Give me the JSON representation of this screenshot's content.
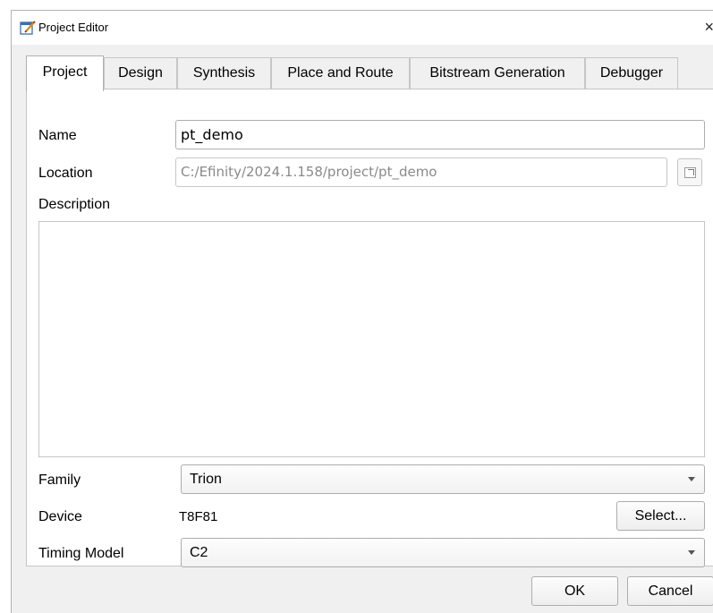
{
  "window": {
    "title": "Project Editor",
    "close_glyph": "×",
    "icon": "project-editor-icon"
  },
  "tabs": [
    {
      "label": "Project",
      "active": true
    },
    {
      "label": "Design",
      "active": false
    },
    {
      "label": "Synthesis",
      "active": false
    },
    {
      "label": "Place and Route",
      "active": false
    },
    {
      "label": "Bitstream Generation",
      "active": false
    },
    {
      "label": "Debugger",
      "active": false
    }
  ],
  "project": {
    "name_label": "Name",
    "name_value": "pt_demo",
    "location_label": "Location",
    "location_value": "C:/Efinity/2024.1.158/project/pt_demo",
    "description_label": "Description",
    "description_value": "",
    "family_label": "Family",
    "family_value": "Trion",
    "device_label": "Device",
    "device_value": "T8F81",
    "select_button": "Select...",
    "timing_label": "Timing Model",
    "timing_value": "C2"
  },
  "footer": {
    "ok_label": "OK",
    "cancel_label": "Cancel"
  }
}
